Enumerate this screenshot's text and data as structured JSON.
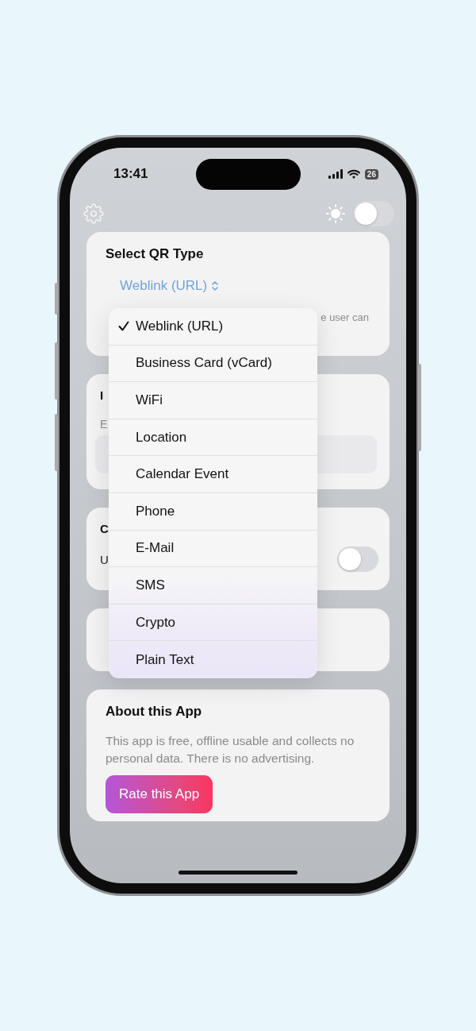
{
  "status_bar": {
    "time": "13:41",
    "battery": "26"
  },
  "top_bar": {
    "appearance_toggle": {
      "on": false
    }
  },
  "type_card": {
    "title": "Select QR Type",
    "picker_value": "Weblink (URL)",
    "hint_fragment": "e user can"
  },
  "input_card": {
    "title_fragment": "I",
    "label_fragment": "E"
  },
  "option_card": {
    "title_fragment": "C",
    "row_label_fragment": "U",
    "toggle": {
      "on": false
    }
  },
  "about_card": {
    "title": "About this App",
    "text": "This app is free, offline usable and collects no personal data. There is no advertising.",
    "button": "Rate this App"
  },
  "type_menu": {
    "items": [
      {
        "label": "Weblink (URL)",
        "selected": true
      },
      {
        "label": "Business Card (vCard)",
        "selected": false
      },
      {
        "label": "WiFi",
        "selected": false
      },
      {
        "label": "Location",
        "selected": false
      },
      {
        "label": "Calendar Event",
        "selected": false
      },
      {
        "label": "Phone",
        "selected": false
      },
      {
        "label": "E-Mail",
        "selected": false
      },
      {
        "label": "SMS",
        "selected": false
      },
      {
        "label": "Crypto",
        "selected": false
      },
      {
        "label": "Plain Text",
        "selected": false
      }
    ]
  }
}
